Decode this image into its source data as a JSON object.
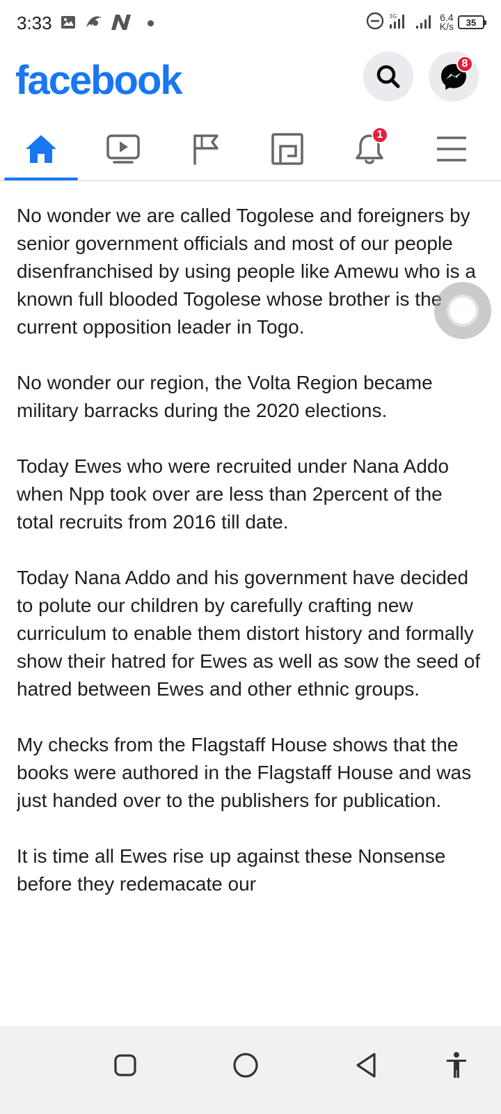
{
  "status_bar": {
    "time": "3:33",
    "net_speed_value": "6.4",
    "net_speed_unit": "K/s",
    "battery": "35",
    "icons": [
      "gallery-icon",
      "app-icon",
      "n-app-icon",
      "dnd-icon",
      "signal-icon",
      "signal-icon-2"
    ]
  },
  "header": {
    "logo": "facebook",
    "messenger_badge": "8",
    "brand_color": "#1877f2",
    "badge_color": "#e41e3f"
  },
  "tabs": [
    {
      "name": "home",
      "icon": "home-icon",
      "active": true
    },
    {
      "name": "watch",
      "icon": "video-icon",
      "active": false
    },
    {
      "name": "pages",
      "icon": "flag-icon",
      "active": false
    },
    {
      "name": "marketplace",
      "icon": "marketplace-icon",
      "active": false
    },
    {
      "name": "notifications",
      "icon": "bell-icon",
      "active": false,
      "badge": "1"
    },
    {
      "name": "menu",
      "icon": "menu-icon",
      "active": false
    }
  ],
  "post": {
    "paragraphs": [
      "No wonder we are called Togolese and foreigners by senior government officials and most of our people disenfranchised by using people like Amewu who is a known full blooded Togolese whose brother is the current opposition leader in Togo.",
      "No wonder our region, the Volta Region became military barracks during the 2020 elections.",
      "Today Ewes who were recruited under Nana Addo when Npp took over are less than 2percent of the total recruits from 2016 till date.",
      "Today Nana Addo and his government have decided to polute our children by carefully crafting new curriculum to enable them distort history and formally show their hatred for Ewes as well as sow the seed of hatred between Ewes and other ethnic groups.",
      "My checks from the Flagstaff House shows that the books were authored in the Flagstaff House and was just handed over to the publishers for publication.",
      "It is time all Ewes rise up against these Nonsense before they redemacate our"
    ]
  },
  "system_nav": [
    "recents-icon",
    "home-circle-icon",
    "back-icon",
    "accessibility-icon"
  ]
}
